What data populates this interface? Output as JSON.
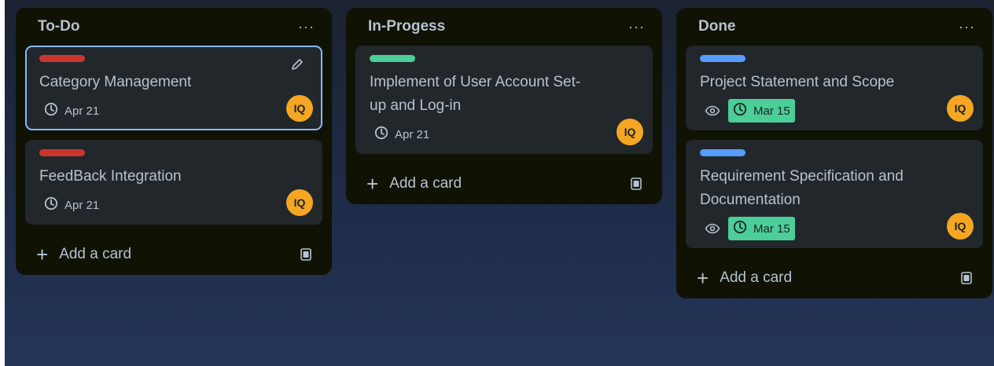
{
  "colors": {
    "label_red": "#c9372c",
    "label_green": "#4bce97",
    "label_blue": "#579dff",
    "avatar": "#f5a623",
    "due_complete": "#4bce97",
    "list_bg": "#101204",
    "card_bg": "#22272b",
    "selected_border": "#85b8ff"
  },
  "lists": [
    {
      "title": "To-Do",
      "menu": "···",
      "add_label": "Add a card",
      "cards": [
        {
          "label_color": "red",
          "title": "Category Management",
          "due": "Apr 21",
          "avatar": "IQ"
        },
        {
          "label_color": "red",
          "title": "FeedBack Integration",
          "due": "Apr 21",
          "avatar": "IQ"
        }
      ]
    },
    {
      "title": "In-Progess",
      "menu": "···",
      "add_label": "Add a card",
      "cards": [
        {
          "label_color": "green",
          "title": "Implement of User Account Set-up and Log-in",
          "due": "Apr 21",
          "avatar": "IQ"
        }
      ]
    },
    {
      "title": "Done",
      "menu": "···",
      "add_label": "Add a card",
      "cards": [
        {
          "label_color": "blue",
          "title": "Project Statement and Scope",
          "due": "Mar 15",
          "avatar": "IQ"
        },
        {
          "label_color": "blue",
          "title": "Requirement Specification and Documentation",
          "due": "Mar 15",
          "avatar": "IQ"
        }
      ]
    }
  ]
}
